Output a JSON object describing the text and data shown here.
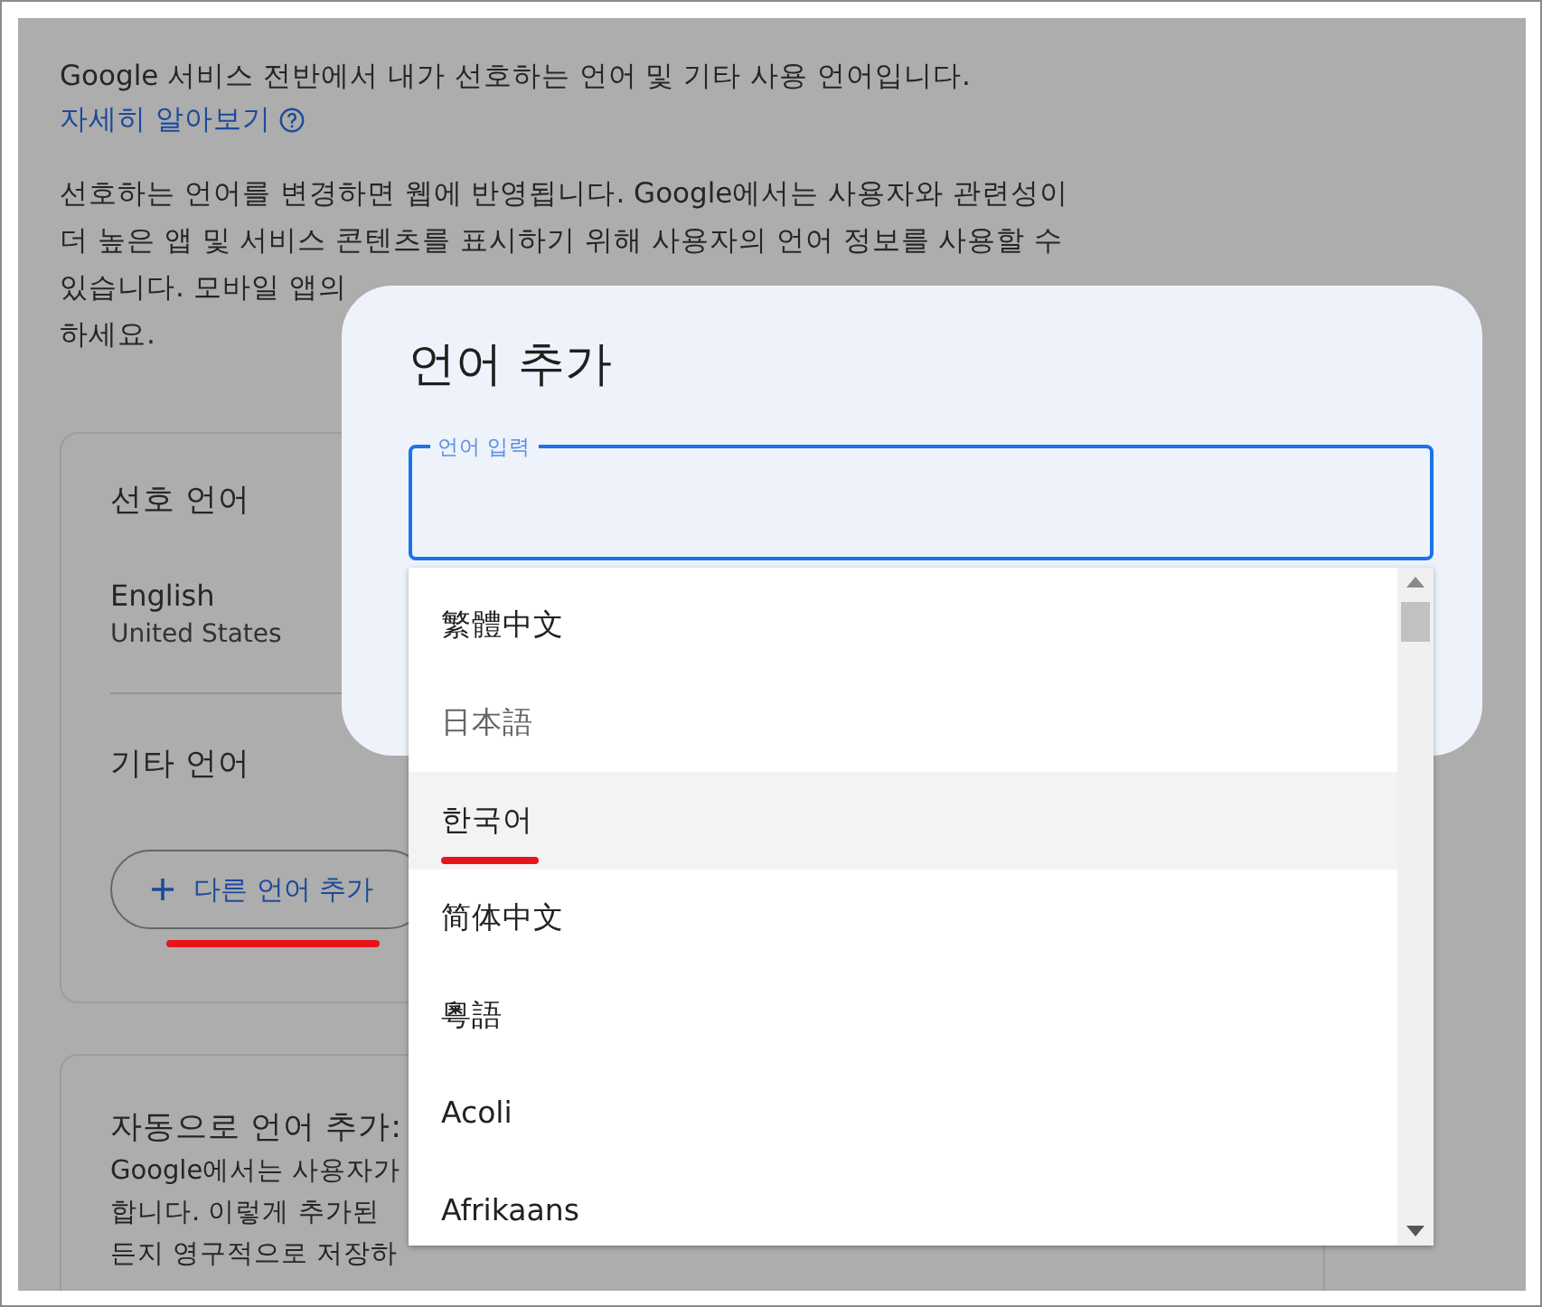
{
  "page": {
    "intro": "Google 서비스 전반에서 내가 선호하는 언어 및 기타 사용 언어입니다.",
    "learn_more": "자세히 알아보기",
    "description_lines": [
      "선호하는 언어를 변경하면 웹에 반영됩니다. Google에서는 사용자와 관련성이",
      "더 높은 앱 및 서비스 콘텐츠를 표시하기 위해 사용자의 언어 정보를 사용할 수",
      "있습니다. 모바일 앱의",
      "하세요."
    ],
    "preferred_card": {
      "title": "선호 언어",
      "language": "English",
      "region": "United States",
      "other_title": "기타 언어",
      "add_button": {
        "label": "다른 언어 추가",
        "annotated": true
      }
    },
    "auto_card": {
      "title": "자동으로 언어 추가:",
      "lines": [
        "Google에서는 사용자가",
        "합니다. 이렇게 추가된",
        "든지 영구적으로 저장하"
      ]
    }
  },
  "dialog": {
    "title": "언어 추가",
    "field": {
      "label": "언어 입력",
      "focused": true
    },
    "options": [
      {
        "label": "繁體中文",
        "disabled": false,
        "selected": false,
        "annotated": false
      },
      {
        "label": "日本語",
        "disabled": true,
        "selected": false,
        "annotated": false
      },
      {
        "label": "한국어",
        "disabled": false,
        "selected": true,
        "annotated": true
      },
      {
        "label": "简体中文",
        "disabled": false,
        "selected": false,
        "annotated": false
      },
      {
        "label": "粵語",
        "disabled": false,
        "selected": false,
        "annotated": false
      },
      {
        "label": "Acoli",
        "disabled": false,
        "selected": false,
        "annotated": false
      },
      {
        "label": "Afrikaans",
        "disabled": false,
        "selected": false,
        "annotated": false
      }
    ]
  }
}
